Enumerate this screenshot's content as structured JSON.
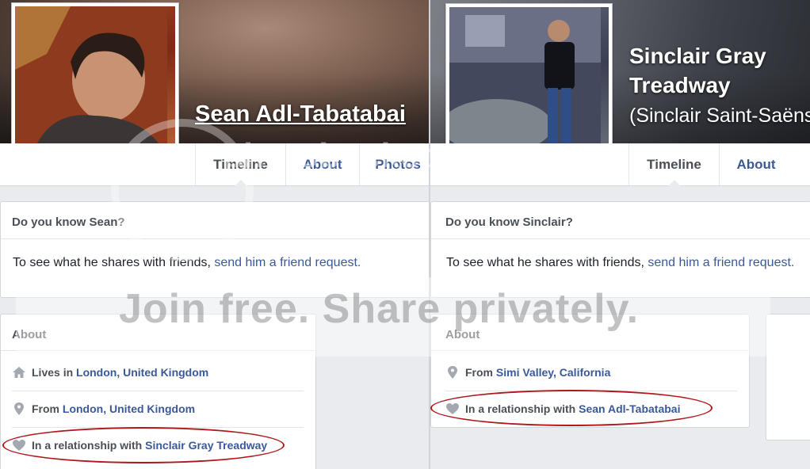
{
  "profile_left": {
    "name": "Sean Adl-Tabatabai",
    "tabs": [
      "Timeline",
      "About",
      "Photos"
    ],
    "active_tab": "Timeline",
    "know_title": "Do you know Sean?",
    "know_text": "To see what he shares with friends, ",
    "know_link": "send him a friend request.",
    "about_title": "About",
    "about_items": [
      {
        "icon": "home-icon",
        "prefix": "Lives in ",
        "value": "London, United Kingdom"
      },
      {
        "icon": "location-pin-icon",
        "prefix": "From ",
        "value": "London, United Kingdom"
      },
      {
        "icon": "heart-icon",
        "prefix": "In a relationship with ",
        "value": "Sinclair Gray Treadway"
      }
    ]
  },
  "profile_right": {
    "name": "Sinclair Gray Treadway",
    "alternate_name": "(Sinclair Saint-Saëns",
    "tabs": [
      "Timeline",
      "About"
    ],
    "active_tab": "Timeline",
    "know_title": "Do you know Sinclair?",
    "know_text": "To see what he shares with friends, ",
    "know_link": "send him a friend request.",
    "about_title": "About",
    "about_items": [
      {
        "icon": "location-pin-icon",
        "prefix": "From ",
        "value": "Simi Valley, California"
      },
      {
        "icon": "heart-icon",
        "prefix": "In a relationship with ",
        "value": "Sean Adl-Tabatabai"
      }
    ]
  },
  "watermark": {
    "logo": "photobucket",
    "text": "Join free. Share privately."
  },
  "colors": {
    "link": "#3b5998",
    "page_bg": "#e9ebee",
    "annotation_oval": "#b0171b"
  }
}
